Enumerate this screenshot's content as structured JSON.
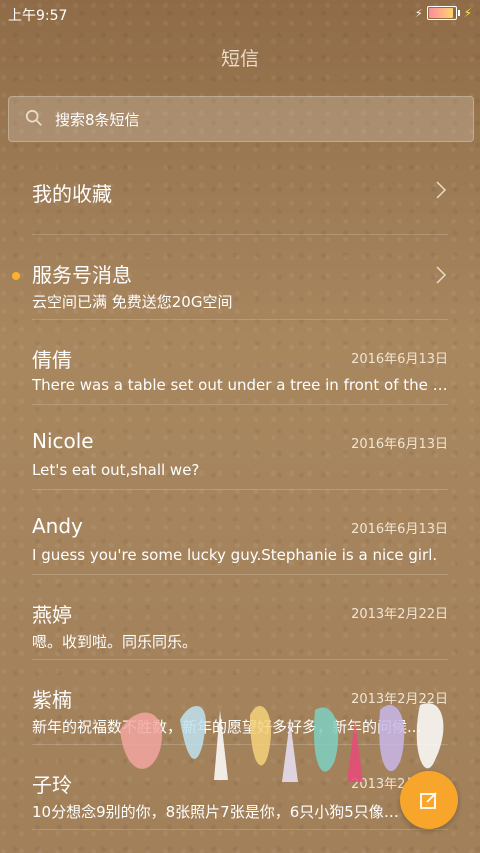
{
  "status_bar": {
    "time": "上午9:57",
    "battery_level": 0.9
  },
  "header": {
    "title": "短信"
  },
  "search": {
    "placeholder": "搜索8条短信"
  },
  "conversations": [
    {
      "title": "我的收藏",
      "snippet": "",
      "date": "",
      "has_chevron": true,
      "unread": false
    },
    {
      "title": "服务号消息",
      "snippet": "云空间已满 免费送您20G空间",
      "date": "",
      "has_chevron": true,
      "unread": true
    },
    {
      "title": "倩倩",
      "snippet": "There was a table set out under a tree in front of the ho...",
      "date": "2016年6月13日"
    },
    {
      "title": "Nicole",
      "snippet": "Let's eat out,shall we?",
      "date": "2016年6月13日"
    },
    {
      "title": "Andy",
      "snippet": "I guess you're some lucky guy.Stephanie is a nice girl.",
      "date": "2016年6月13日"
    },
    {
      "title": "燕婷",
      "snippet": "嗯。收到啦。同乐同乐。",
      "date": "2013年2月22日"
    },
    {
      "title": "紫楠",
      "snippet": "新年的祝福数不胜数，新年的愿望好多好多，新年的问候...",
      "date": "2013年2月22日"
    },
    {
      "title": "子玲",
      "snippet": "10分想念9别的你，8张照片7张是你，6只小狗5只像你...",
      "date": "2013年2月22日"
    }
  ],
  "icons": {
    "search": "search-icon",
    "chevron": "chevron-right-icon",
    "compose": "compose-icon"
  },
  "colors": {
    "accent": "#f7a62b",
    "unread_dot": "#ffb12c"
  }
}
